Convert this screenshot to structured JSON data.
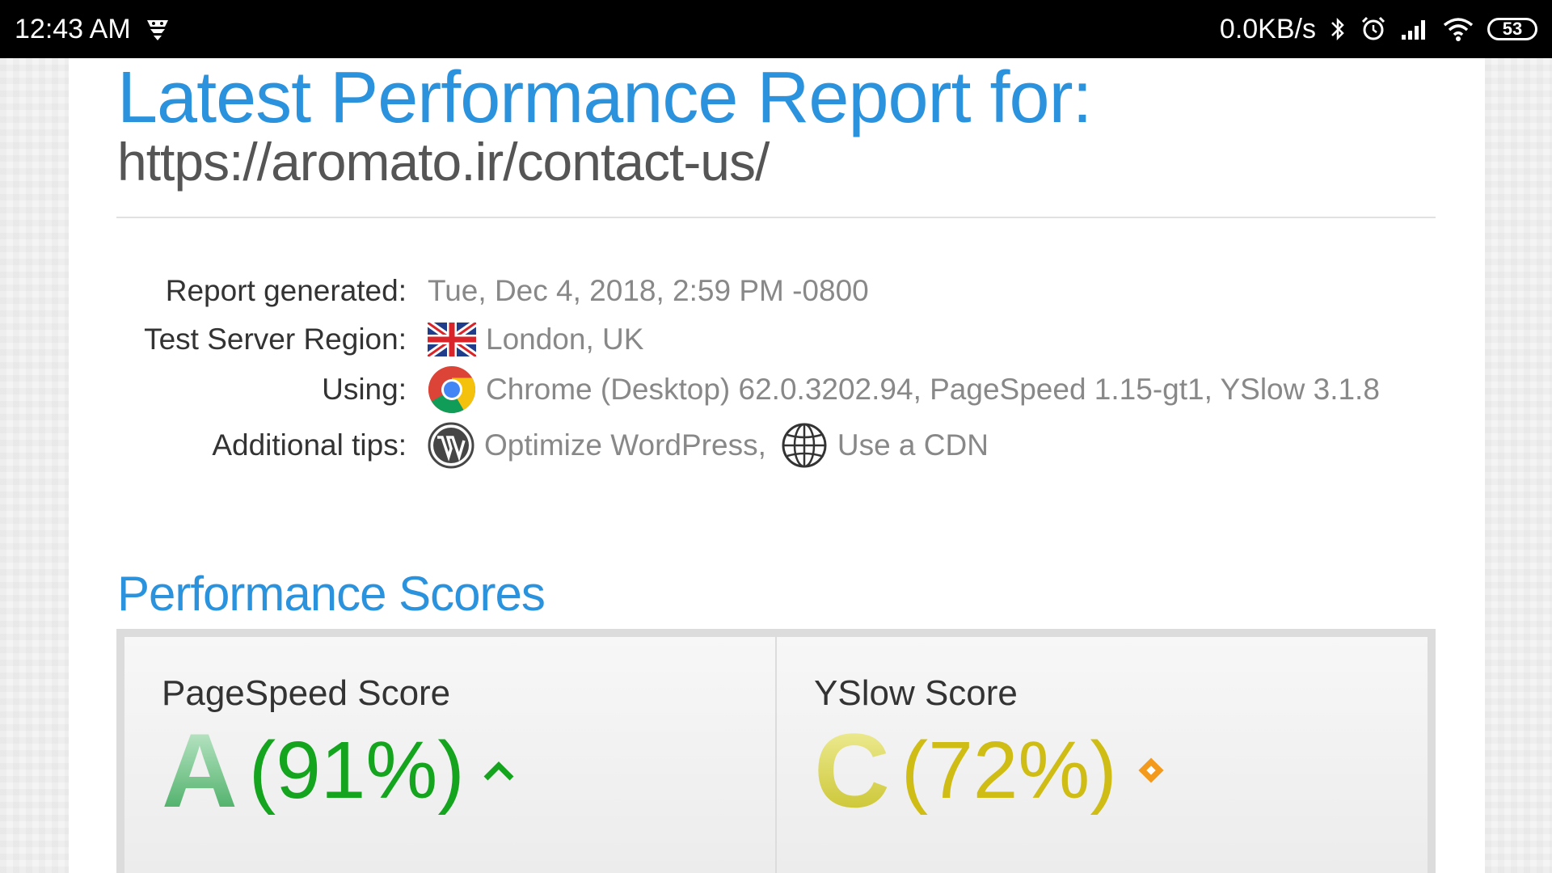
{
  "status_bar": {
    "time": "12:43 AM",
    "net_speed": "0.0KB/s",
    "battery": "53",
    "icons": [
      "notification-icon",
      "bluetooth-icon",
      "alarm-icon",
      "signal-icon",
      "wifi-icon",
      "battery-icon"
    ]
  },
  "report": {
    "title": "Latest Performance Report for:",
    "url": "https://aromato.ir/contact-us/"
  },
  "details": {
    "generated_label": "Report generated:",
    "generated_value": "Tue, Dec 4, 2018, 2:59 PM -0800",
    "region_label": "Test Server Region:",
    "region_value": "London, UK",
    "region_icon": "uk-flag-icon",
    "using_label": "Using:",
    "using_value": "Chrome (Desktop) 62.0.3202.94, PageSpeed 1.15-gt1, YSlow 3.1.8",
    "using_icon": "chrome-icon",
    "tips_label": "Additional tips:",
    "tip_1": "Optimize WordPress,",
    "tip_1_icon": "wordpress-icon",
    "tip_2": "Use a CDN",
    "tip_2_icon": "globe-icon"
  },
  "scores": {
    "section_title": "Performance Scores",
    "pagespeed": {
      "label": "PageSpeed Score",
      "grade": "A",
      "percent": "(91%)",
      "trend_icon": "chevron-up-icon",
      "color": "#14a41e"
    },
    "yslow": {
      "label": "YSlow Score",
      "grade": "C",
      "percent": "(72%)",
      "trend_icon": "diamond-icon",
      "color": "#cfbd16"
    }
  },
  "colors": {
    "accent": "#2b93dd",
    "status_bar_bg": "#000000"
  }
}
